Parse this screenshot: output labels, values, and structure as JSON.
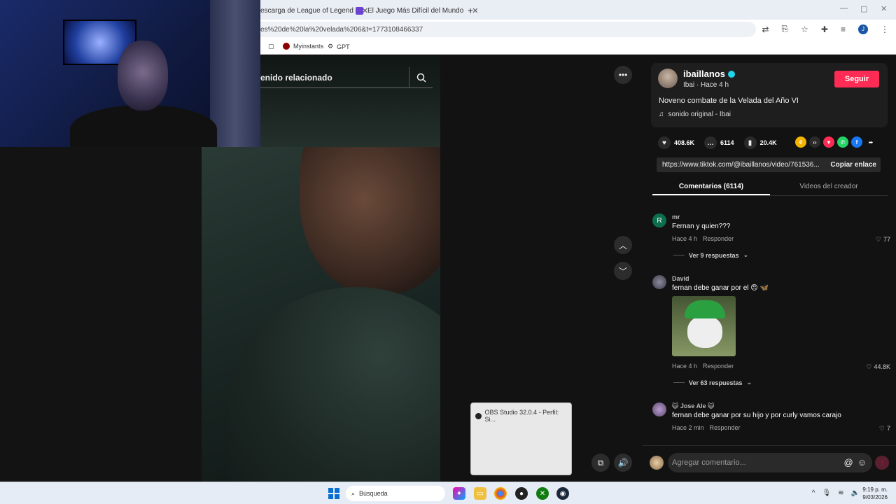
{
  "browser": {
    "tabs": [
      {
        "label": "escarga de League of Legend"
      },
      {
        "label": "El Juego Más Difícil del Mundo"
      }
    ],
    "url": "es%20de%20la%20velada%206&t=1773108466337",
    "bookmarks": [
      {
        "label": "Myinstants"
      },
      {
        "label": "GPT"
      }
    ],
    "profile_initial": "J"
  },
  "video": {
    "related_search_text": "enido relacionado",
    "obs_popup_title": "OBS Studio 32.0.4 - Perfil: Si..."
  },
  "creator": {
    "username": "ibaillanos",
    "subtitle": "Ibai · Hace 4 h",
    "follow_label": "Seguir",
    "description": "Noveno combate de la Velada del Año VI",
    "sound": "sonido original - Ibai"
  },
  "stats": {
    "likes": "408.6K",
    "comments": "6114",
    "saves": "20.4K"
  },
  "link": {
    "url": "https://www.tiktok.com/@ibaillanos/video/761536...",
    "copy_label": "Copiar enlace"
  },
  "tabs": {
    "comments": "Comentarios (6114)",
    "creator_videos": "Videos del creador"
  },
  "comments": [
    {
      "avatar": "R",
      "user": "mr",
      "text": "Fernan y quien???",
      "time": "Hace 4 h",
      "reply": "Responder",
      "likes": "77",
      "replies": "Ver 9 respuestas"
    },
    {
      "avatar": "",
      "user": "David",
      "text": "fernan debe ganar por el 😠 🦋",
      "time": "Hace 4 h",
      "reply": "Responder",
      "likes": "44.8K",
      "replies": "Ver 63 respuestas"
    },
    {
      "avatar": "",
      "user": "😺 Jose Ale 😺",
      "text": "fernan debe ganar por su hijo y por curly vamos carajo",
      "time": "Hace 2 min",
      "reply": "Responder",
      "likes": "7"
    }
  ],
  "comment_bar": {
    "placeholder": "Agregar comentario..."
  },
  "taskbar": {
    "search": "Búsqueda",
    "time": "9:19 p. m.",
    "date": "9/03/2026"
  },
  "colors": {
    "accent": "#fe2c55",
    "verified": "#20d5ec"
  }
}
